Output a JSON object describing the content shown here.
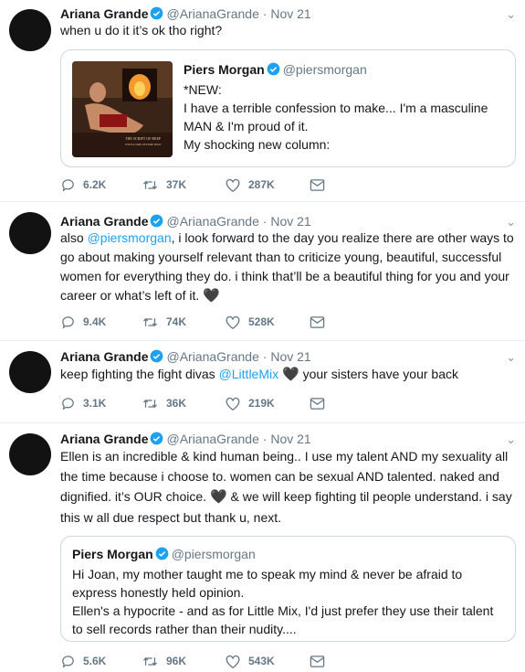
{
  "tweets": [
    {
      "name": "Ariana Grande",
      "handle": "@ArianaGrande",
      "dot": "·",
      "date": "Nov 21",
      "text": "when u do it it’s ok tho right?",
      "quote": {
        "name": "Piers Morgan",
        "handle": "@piersmorgan",
        "lines": [
          "*NEW:",
          "I have a terrible confession to make... I'm a masculine",
          "MAN & I'm proud of it.",
          "My shocking new column:"
        ]
      },
      "replies": "6.2K",
      "retweets": "37K",
      "likes": "287K"
    },
    {
      "name": "Ariana Grande",
      "handle": "@ArianaGrande",
      "dot": "·",
      "date": "Nov 21",
      "prefix": "also ",
      "mention": "@piersmorgan",
      "lines": [
        ", i look forward to the day you realize there are other ways to",
        "go about making yourself relevant than to criticize young, beautiful, successful",
        "women for everything they do. i think that’ll be a beautiful thing for you and your",
        "career or what’s left of it."
      ],
      "replies": "9.4K",
      "retweets": "74K",
      "likes": "528K"
    },
    {
      "name": "Ariana Grande",
      "handle": "@ArianaGrande",
      "dot": "·",
      "date": "Nov 21",
      "prefix": "keep fighting the fight divas ",
      "mention": "@LittleMix",
      "suffix": " your sisters have your back",
      "replies": "3.1K",
      "retweets": "36K",
      "likes": "219K"
    },
    {
      "name": "Ariana Grande",
      "handle": "@ArianaGrande",
      "dot": "·",
      "date": "Nov 21",
      "lines": [
        "Ellen is an incredible & kind human being.. I use my talent AND my sexuality all",
        "the time because i choose to. women can be sexual AND talented. naked and",
        "dignified. it’s OUR choice.",
        " & we will keep fighting til people understand. i say",
        "this w all due respect but thank u, next."
      ],
      "quote": {
        "name": "Piers Morgan",
        "handle": "@piersmorgan",
        "lines": [
          "Hi Joan, my mother taught me to speak my mind & never be afraid to",
          "express honestly held opinion.",
          "Ellen's a hypocrite - and as for Little Mix, I'd just prefer they use their talent",
          "to sell records rather than their nudity...."
        ]
      },
      "replies": "5.6K",
      "retweets": "96K",
      "likes": "543K"
    }
  ]
}
